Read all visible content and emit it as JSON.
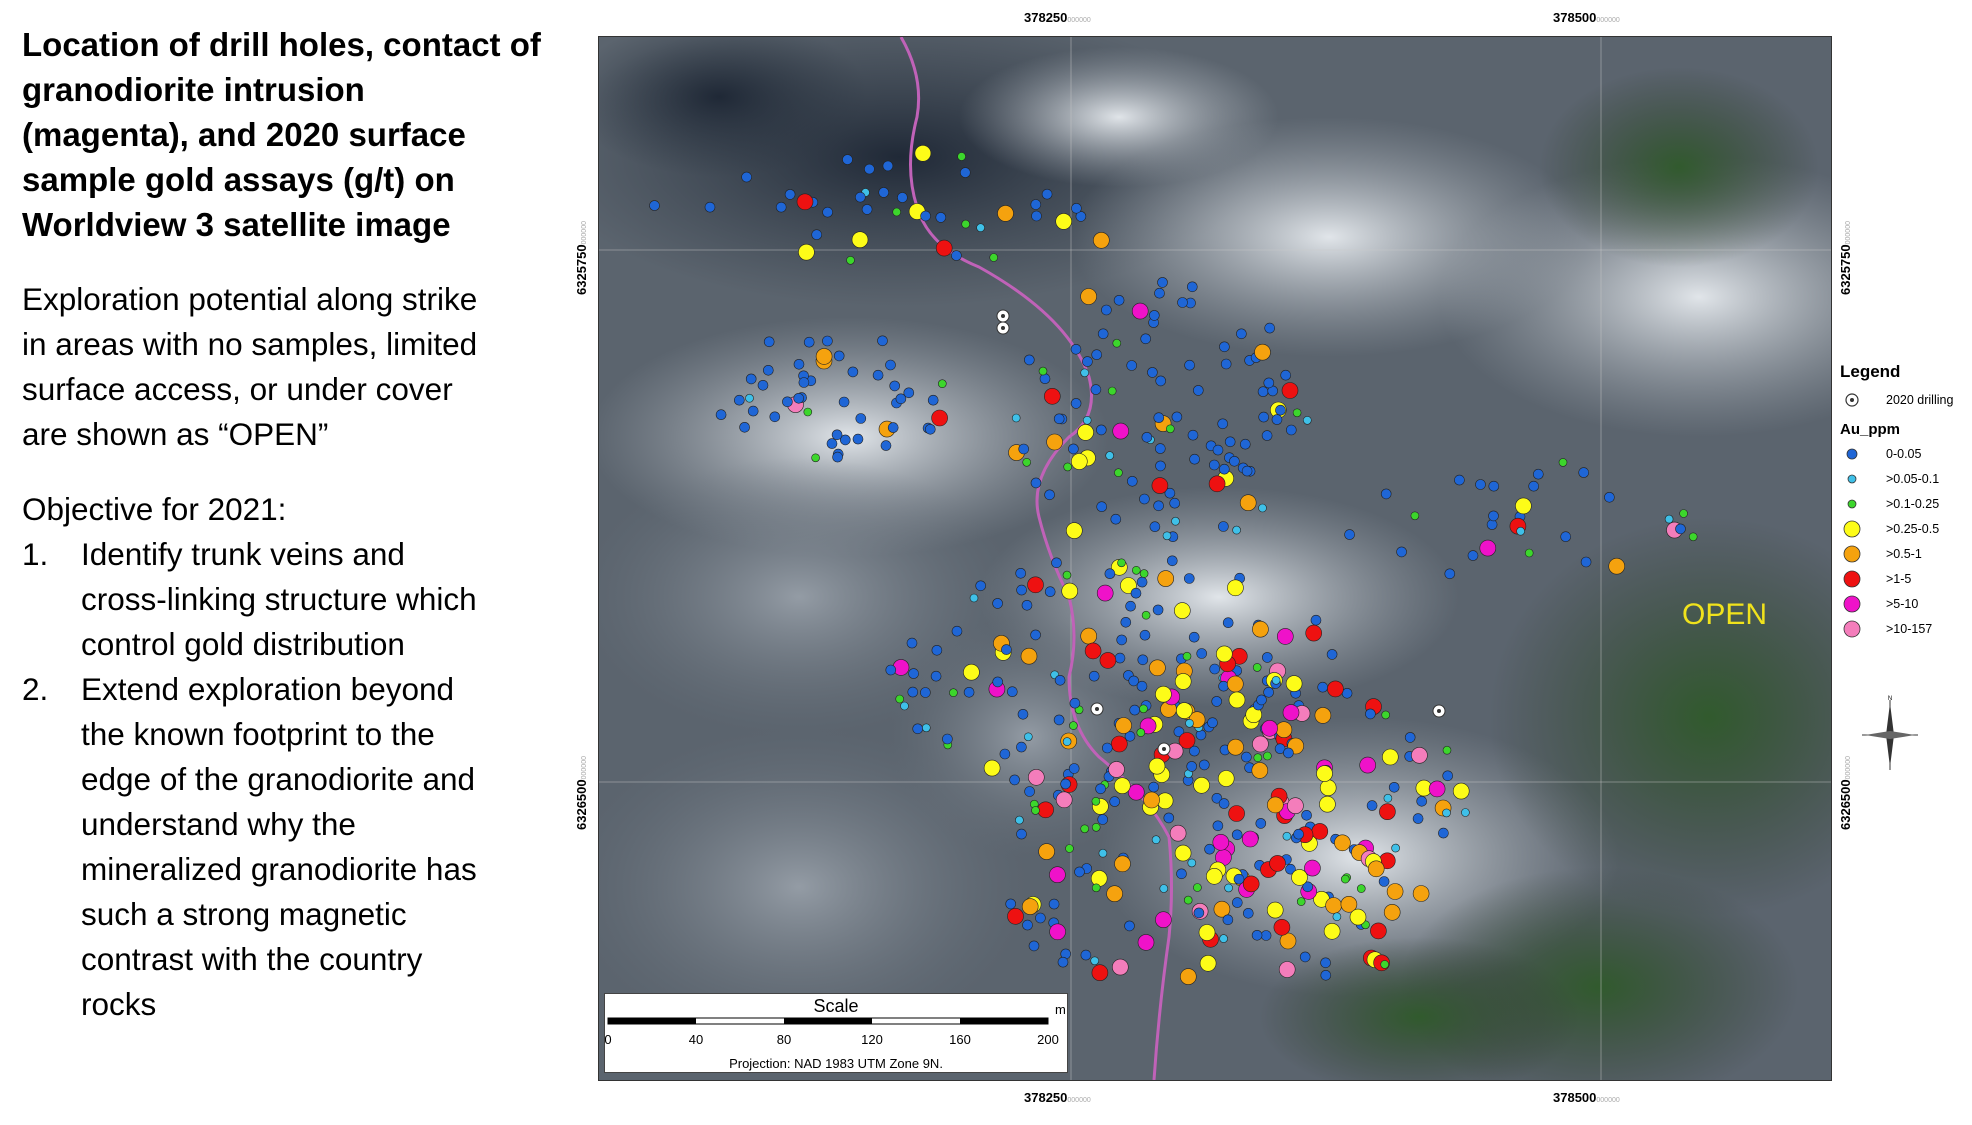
{
  "text_panel": {
    "title_lines": [
      "Location of drill holes, contact of",
      "granodiorite intrusion",
      "(magenta), and 2020 surface",
      "sample gold assays (g/t) on",
      "Worldview 3  satellite image"
    ],
    "potential_lines": [
      "Exploration potential along strike",
      "in areas with no samples, limited",
      "surface access, or under cover",
      "are shown as “OPEN”"
    ],
    "objective_heading": "Objective for 2021:",
    "objectives": [
      {
        "num": "1.",
        "lines": [
          "Identify trunk veins and",
          "cross-linking structure which",
          "control gold distribution"
        ]
      },
      {
        "num": "2.",
        "lines": [
          "Extend exploration beyond",
          "the known footprint to the",
          "edge of the granodiorite and",
          "understand why the",
          "mineralized granodiorite has",
          "such a strong magnetic",
          "contrast with the country",
          "rocks"
        ]
      }
    ]
  },
  "map": {
    "easting_labels": [
      "378250",
      "378500"
    ],
    "northing_labels": [
      "6325750",
      "6326500"
    ],
    "coord_suffix": "000000",
    "open_label": "OPEN"
  },
  "scale": {
    "title": "Scale",
    "unit": "m",
    "ticks": [
      "0",
      "40",
      "80",
      "120",
      "160",
      "200"
    ],
    "projection": "Projection: NAD 1983 UTM Zone 9N."
  },
  "legend": {
    "title": "Legend",
    "drilling_label": "2020 drilling",
    "au_title": "Au_ppm",
    "classes": [
      {
        "label": "0-0.05",
        "color": "#1f66d6",
        "size": 6
      },
      {
        "label": ">0.05-0.1",
        "color": "#3fc0e8",
        "size": 5
      },
      {
        "label": ">0.1-0.25",
        "color": "#3cd62c",
        "size": 5
      },
      {
        "label": ">0.25-0.5",
        "color": "#fdfc18",
        "size": 9
      },
      {
        "label": ">0.5-1",
        "color": "#f5a20e",
        "size": 9
      },
      {
        "label": ">1-5",
        "color": "#ee1111",
        "size": 9
      },
      {
        "label": ">5-10",
        "color": "#ef12c9",
        "size": 9
      },
      {
        "label": ">10-157",
        "color": "#f47dbb",
        "size": 9
      }
    ]
  },
  "colors": {
    "contact_line": "#c062b8",
    "drill_hole": "#ffffff"
  }
}
